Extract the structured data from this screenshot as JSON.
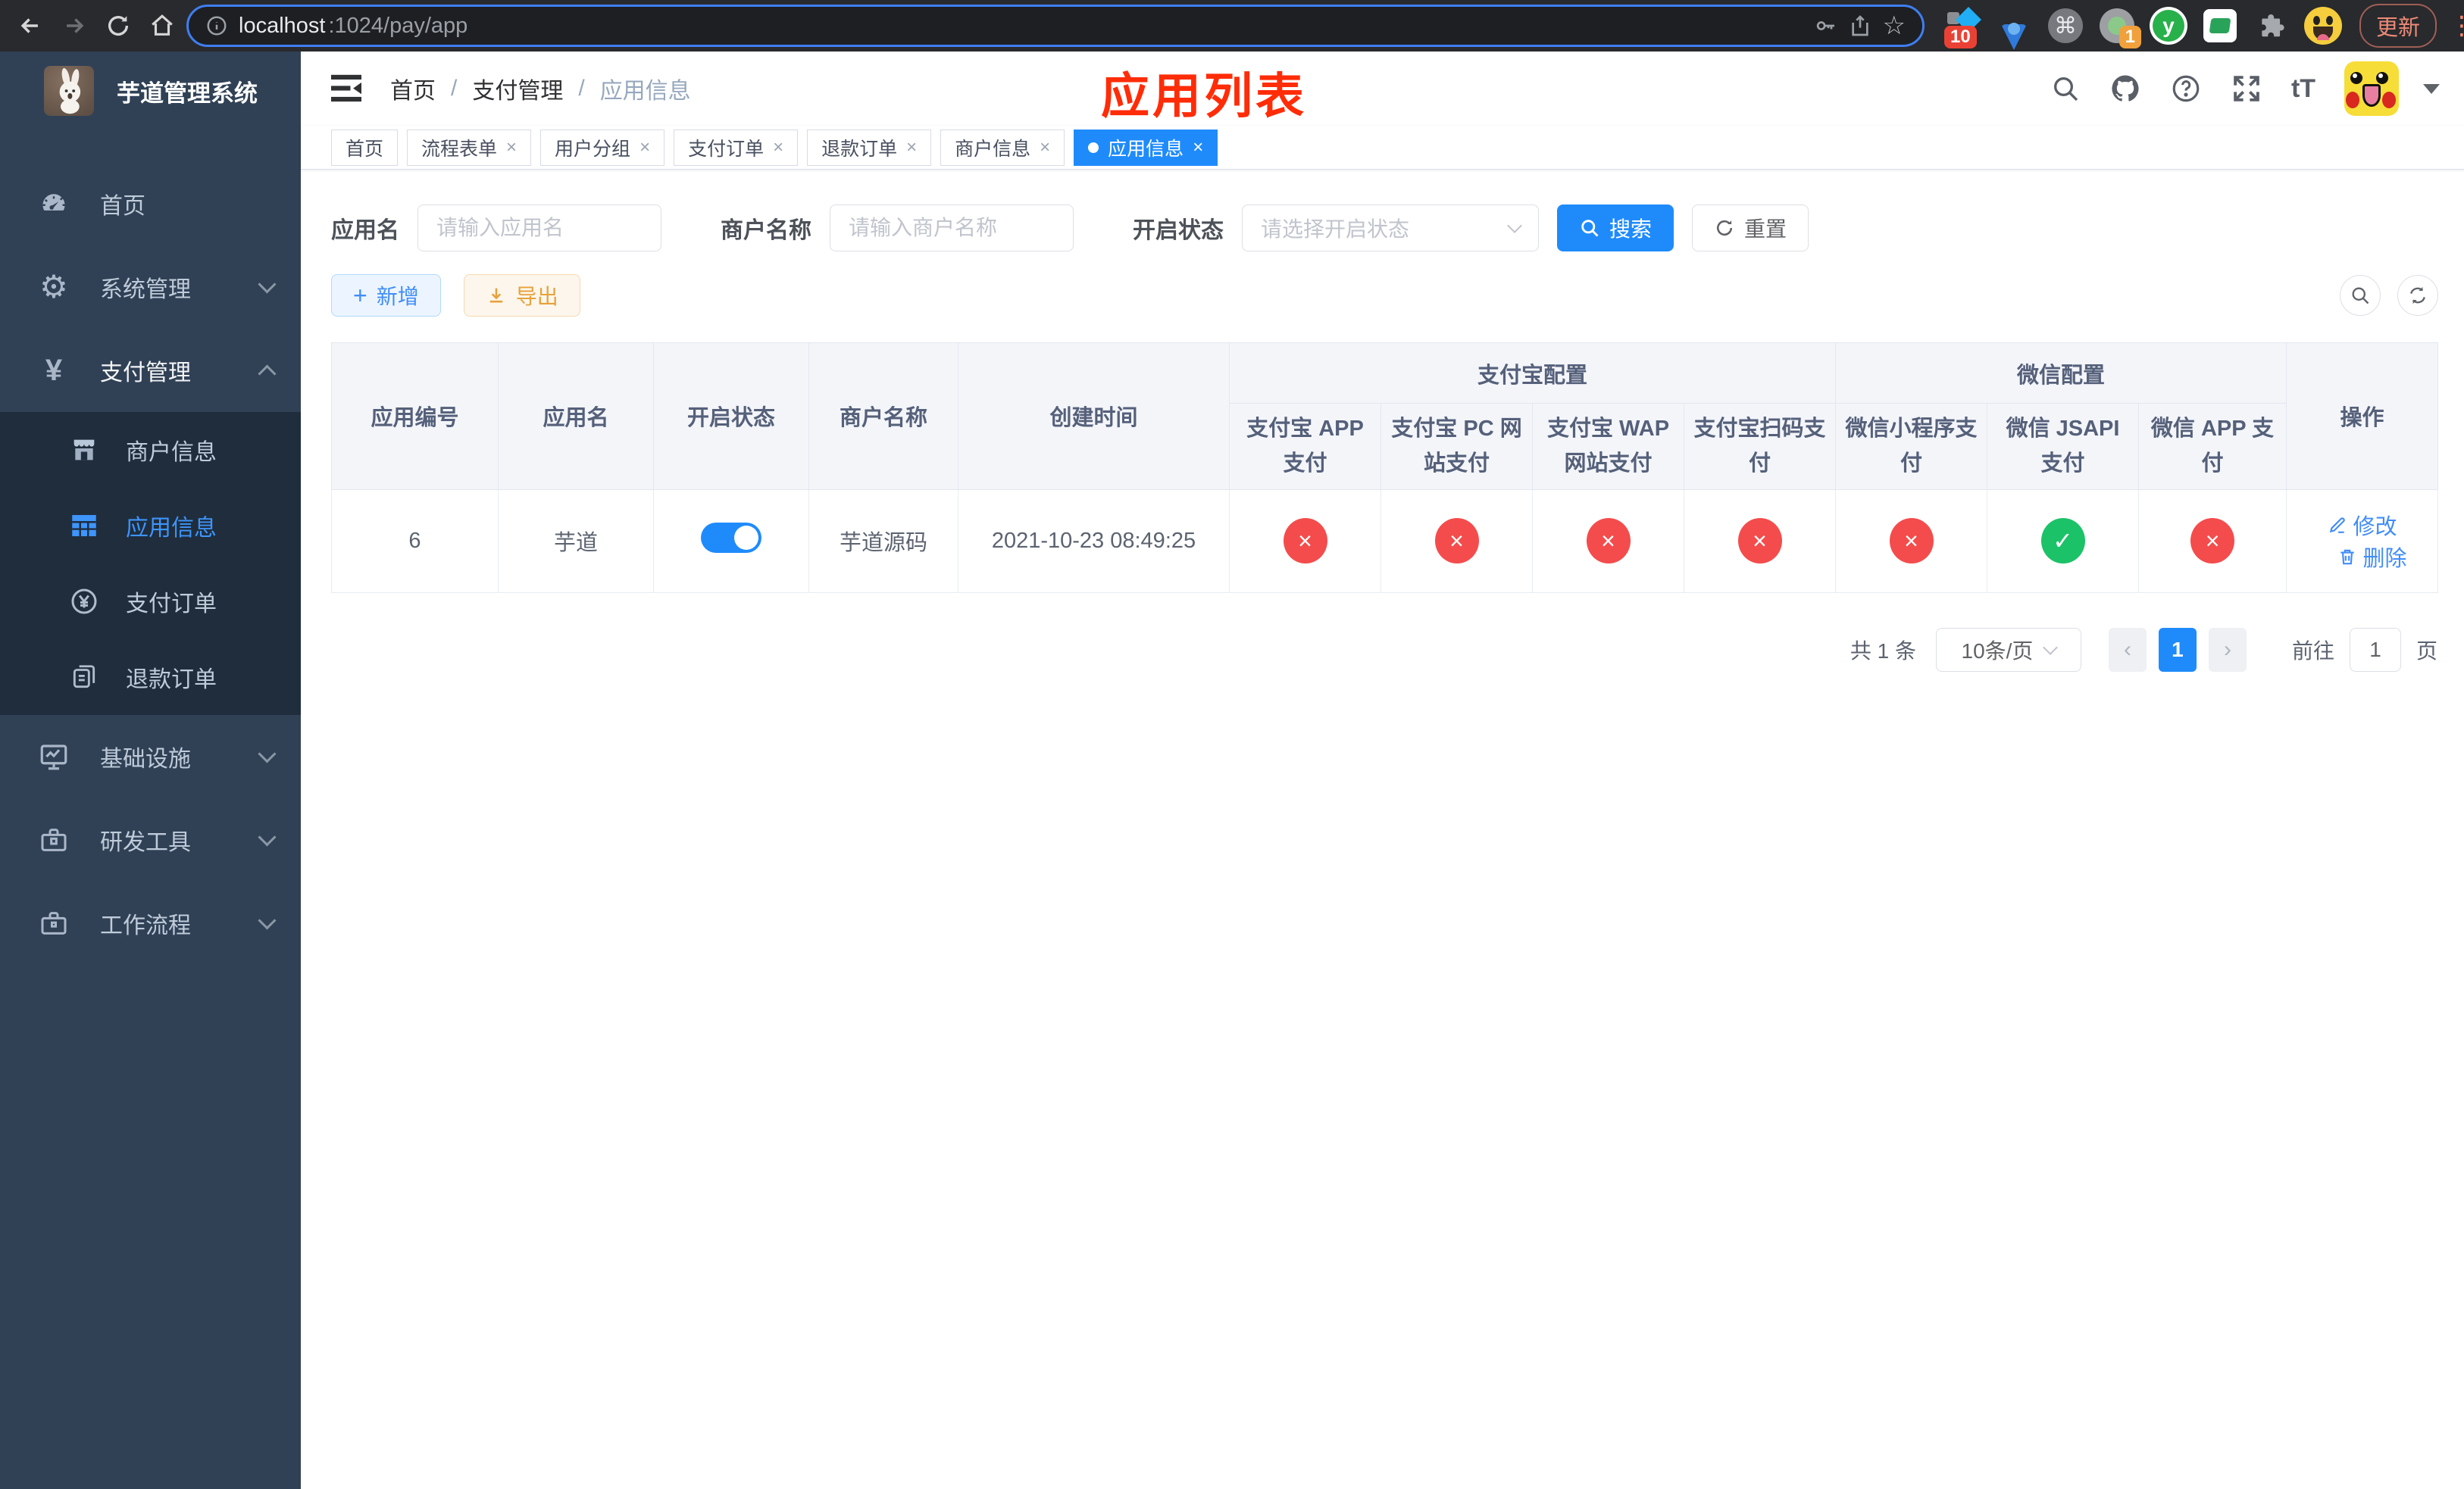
{
  "colors": {
    "primary": "#1f8bfb",
    "link_blue": "#418df9",
    "danger_red": "#f44c4c",
    "success_green": "#1cc268",
    "export_orange": "#e6a23c",
    "annotation_red": "#ff2c08",
    "sidebar_bg": "#304156",
    "submenu_bg": "#1f2d3d"
  },
  "icons": {
    "check": "✓",
    "close": "×",
    "command": "⌘",
    "question": "?",
    "font_size": "tT",
    "yuan": "¥",
    "dots": "⋮",
    "star": "☆",
    "prev": "‹",
    "next": "›",
    "slash": "/",
    "plus": "+"
  },
  "browser": {
    "url_host": "localhost",
    "url_path": ":1024/pay/app",
    "ext_badge_devtools": "10",
    "ext_badge_proxy": "1",
    "ext_y_label": "y",
    "update_label": "更新"
  },
  "sidebar": {
    "title": "芋道管理系统",
    "items": [
      {
        "label": "首页"
      },
      {
        "label": "系统管理"
      },
      {
        "label": "支付管理"
      },
      {
        "label": "商户信息"
      },
      {
        "label": "应用信息"
      },
      {
        "label": "支付订单"
      },
      {
        "label": "退款订单"
      },
      {
        "label": "基础设施"
      },
      {
        "label": "研发工具"
      },
      {
        "label": "工作流程"
      }
    ]
  },
  "header": {
    "breadcrumb": [
      "首页",
      "支付管理",
      "应用信息"
    ],
    "annotation": "应用列表"
  },
  "tabs": {
    "items": [
      {
        "label": "首页"
      },
      {
        "label": "流程表单"
      },
      {
        "label": "用户分组"
      },
      {
        "label": "支付订单"
      },
      {
        "label": "退款订单"
      },
      {
        "label": "商户信息"
      },
      {
        "label": "应用信息"
      }
    ]
  },
  "filters": {
    "app_name_label": "应用名",
    "app_name_placeholder": "请输入应用名",
    "merchant_label": "商户名称",
    "merchant_placeholder": "请输入商户名称",
    "status_label": "开启状态",
    "status_placeholder": "请选择开启状态",
    "search_label": "搜索",
    "reset_label": "重置"
  },
  "toolbar": {
    "add_label": "新增",
    "export_label": "导出"
  },
  "table": {
    "groups": {
      "alipay": "支付宝配置",
      "wechat": "微信配置"
    },
    "columns": {
      "app_id": "应用编号",
      "app_name": "应用名",
      "status": "开启状态",
      "merchant": "商户名称",
      "created": "创建时间",
      "alipay_app": "支付宝 APP 支付",
      "alipay_pc": "支付宝 PC 网站支付",
      "alipay_wap": "支付宝 WAP 网站支付",
      "alipay_qr": "支付宝扫码支付",
      "wx_mini": "微信小程序支付",
      "wx_jsapi": "微信 JSAPI 支付",
      "wx_app": "微信 APP 支付",
      "actions": "操作"
    },
    "row": {
      "id": "6",
      "name": "芋道",
      "enabled": true,
      "merchant": "芋道源码",
      "created": "2021-10-23 08:49:25",
      "channels": [
        false,
        false,
        false,
        false,
        false,
        true,
        false
      ],
      "edit_label": "修改",
      "delete_label": "删除"
    }
  },
  "pagination": {
    "total": "共 1 条",
    "page_size": "10条/页",
    "current": "1",
    "goto_prefix": "前往",
    "goto_value": "1",
    "goto_suffix": "页"
  }
}
